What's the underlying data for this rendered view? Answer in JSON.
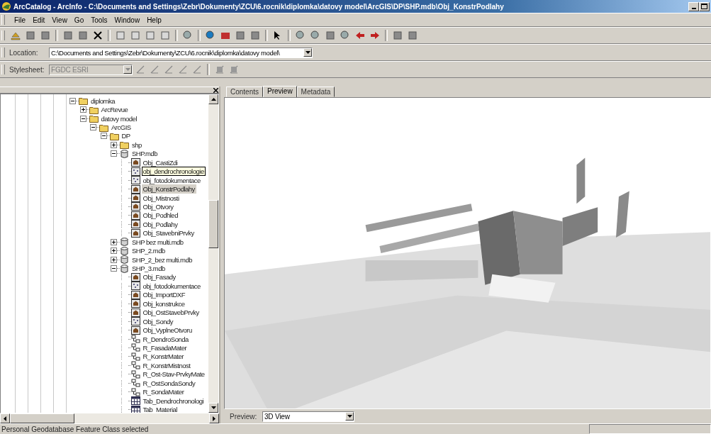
{
  "window": {
    "title": "ArcCatalog - ArcInfo - C:\\Documents and Settings\\Zebr\\Dokumenty\\ZCU\\6.rocnik\\diplomka\\datovy model\\ArcGIS\\DP\\SHP.mdb\\Obj_KonstrPodlahy"
  },
  "menu": [
    "File",
    "Edit",
    "View",
    "Go",
    "Tools",
    "Window",
    "Help"
  ],
  "location": {
    "label": "Location:",
    "value": "C:\\Documents and Settings\\Zebr\\Dokumenty\\ZCU\\6.rocnik\\diplomka\\datovy model\\"
  },
  "stylesheet": {
    "label": "Stylesheet:",
    "value": "FGDC ESRI",
    "disabled": true
  },
  "tree": [
    {
      "label": "diplomka",
      "kind": "folder",
      "selected": false,
      "expanded": true,
      "children": [
        {
          "label": "ArcRevue",
          "kind": "folder",
          "selected": false,
          "expanded": false
        },
        {
          "label": "datovy model",
          "kind": "folder",
          "selected": false,
          "expanded": true,
          "children": [
            {
              "label": "ArcGIS",
              "kind": "folder",
              "selected": false,
              "expanded": true,
              "children": [
                {
                  "label": "DP",
                  "kind": "folder",
                  "selected": false,
                  "expanded": true,
                  "children": [
                    {
                      "label": "shp",
                      "kind": "folder",
                      "selected": false,
                      "expanded": false
                    },
                    {
                      "label": "SHP.mdb",
                      "kind": "database",
                      "selected": false,
                      "expanded": true,
                      "children": [
                        {
                          "label": "Obj_CastiZdi",
                          "kind": "polygon",
                          "selected": false
                        },
                        {
                          "label": "obj_dendrochronologie",
                          "kind": "point",
                          "selected": false,
                          "hovered": true
                        },
                        {
                          "label": "obj_fotodokumentace",
                          "kind": "point",
                          "selected": false
                        },
                        {
                          "label": "Obj_KonstrPodlahy",
                          "kind": "polygon",
                          "selected": true
                        },
                        {
                          "label": "Obj_Mistnosti",
                          "kind": "polygon",
                          "selected": false
                        },
                        {
                          "label": "Obj_Otvory",
                          "kind": "polygon",
                          "selected": false
                        },
                        {
                          "label": "Obj_Podhled",
                          "kind": "polygon",
                          "selected": false
                        },
                        {
                          "label": "Obj_Podlahy",
                          "kind": "polygon",
                          "selected": false
                        },
                        {
                          "label": "Obj_StavebniPrvky",
                          "kind": "polygon",
                          "selected": false
                        }
                      ]
                    },
                    {
                      "label": "SHP bez multi.mdb",
                      "kind": "database",
                      "selected": false,
                      "expanded": false
                    },
                    {
                      "label": "SHP_2.mdb",
                      "kind": "database",
                      "selected": false,
                      "expanded": false
                    },
                    {
                      "label": "SHP_2_bez multi.mdb",
                      "kind": "database",
                      "selected": false,
                      "expanded": false
                    },
                    {
                      "label": "SHP_3.mdb",
                      "kind": "database",
                      "selected": false,
                      "expanded": true,
                      "children": [
                        {
                          "label": "Obj_Fasady",
                          "kind": "polygon",
                          "selected": false
                        },
                        {
                          "label": "obj_fotodokumentace",
                          "kind": "point",
                          "selected": false
                        },
                        {
                          "label": "Obj_ImportDXF",
                          "kind": "polygon",
                          "selected": false
                        },
                        {
                          "label": "Obj_konstrukce",
                          "kind": "polygon",
                          "selected": false
                        },
                        {
                          "label": "Obj_OstStavebPrvky",
                          "kind": "polygon",
                          "selected": false
                        },
                        {
                          "label": "Obj_Sondy",
                          "kind": "point",
                          "selected": false
                        },
                        {
                          "label": "Obj_VyplneOtvoru",
                          "kind": "polygon",
                          "selected": false
                        },
                        {
                          "label": "R_DendroSonda",
                          "kind": "relationship",
                          "selected": false
                        },
                        {
                          "label": "R_FasadaMater",
                          "kind": "relationship",
                          "selected": false
                        },
                        {
                          "label": "R_KonstrMater",
                          "kind": "relationship",
                          "selected": false
                        },
                        {
                          "label": "R_KonstrMistnost",
                          "kind": "relationship",
                          "selected": false
                        },
                        {
                          "label": "R_Ost-Stav-PrvkyMate",
                          "kind": "relationship",
                          "selected": false
                        },
                        {
                          "label": "R_OstSondaSondy",
                          "kind": "relationship",
                          "selected": false
                        },
                        {
                          "label": "R_SondaMater",
                          "kind": "relationship",
                          "selected": false
                        },
                        {
                          "label": "Tab_Dendrochronologi",
                          "kind": "table",
                          "selected": false
                        },
                        {
                          "label": "Tab_Material",
                          "kind": "table",
                          "selected": false
                        }
                      ]
                    }
                  ]
                }
              ]
            }
          ]
        }
      ]
    }
  ],
  "tabs": [
    {
      "label": "Contents",
      "selected": false
    },
    {
      "label": "Preview",
      "selected": true
    },
    {
      "label": "Metadata",
      "selected": false
    }
  ],
  "preview": {
    "label": "Preview:",
    "value": "3D View"
  },
  "status_bar": {
    "text": "Personal Geodatabase Feature Class selected"
  }
}
